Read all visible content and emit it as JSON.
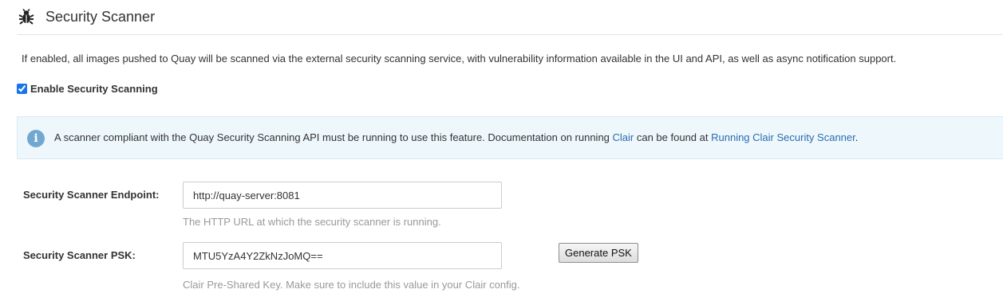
{
  "section": {
    "title": "Security Scanner",
    "icon": "bug-icon"
  },
  "description": "If enabled, all images pushed to Quay will be scanned via the external security scanning service, with vulnerability information available in the UI and API, as well as async notification support.",
  "enable_scanning": {
    "label": "Enable Security Scanning",
    "checked": true
  },
  "info": {
    "icon": "info-icon",
    "text_before": "A scanner compliant with the Quay Security Scanning API must be running to use this feature. Documentation on running ",
    "link1": "Clair",
    "text_middle": " can be found at ",
    "link2": "Running Clair Security Scanner",
    "text_after": "."
  },
  "endpoint": {
    "label": "Security Scanner Endpoint:",
    "value": "http://quay-server:8081",
    "help": "The HTTP URL at which the security scanner is running."
  },
  "psk": {
    "label": "Security Scanner PSK:",
    "value": "MTU5YzA4Y2ZkNzJoMQ==",
    "help": "Clair Pre-Shared Key. Make sure to include this value in your Clair config.",
    "generate_label": "Generate PSK"
  },
  "colors": {
    "link": "#2a6cb0",
    "info_bg": "#eef7fb",
    "info_icon": "#72a8d0",
    "help_text": "#999999"
  }
}
